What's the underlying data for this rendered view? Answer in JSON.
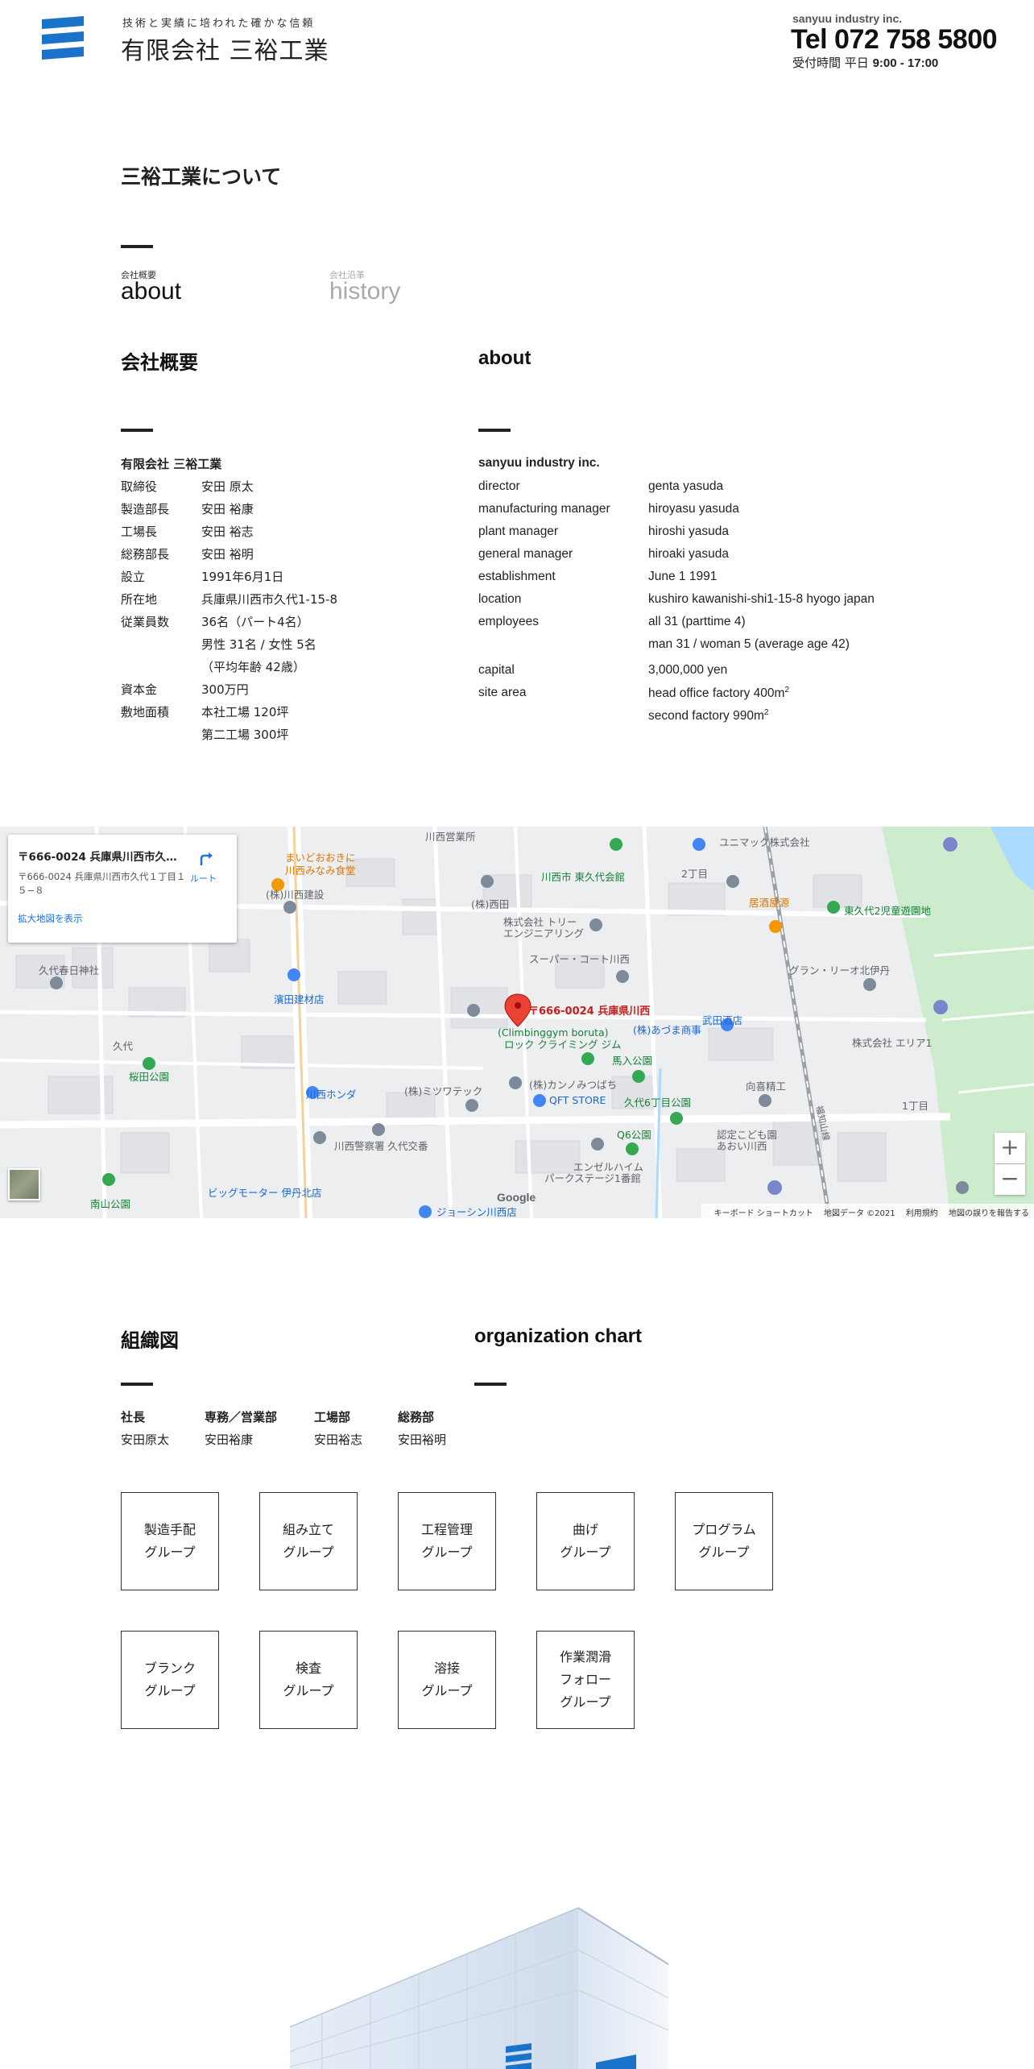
{
  "header": {
    "tagline": "技術と実績に培われた確かな信頼",
    "company_name": "有限会社 三裕工業",
    "company_en": "sanyuu industry inc.",
    "tel": "Tel 072 758 5800",
    "hours_label": "受付時間 平日",
    "hours_time": "9:00 - 17:00"
  },
  "page_title": "三裕工業について",
  "tabs": [
    {
      "small": "会社概要",
      "big": "about"
    },
    {
      "small": "会社沿革",
      "big": "history"
    }
  ],
  "overview_jp": {
    "heading": "会社概要",
    "company": "有限会社 三裕工業",
    "rows": [
      {
        "label": "取締役",
        "values": [
          "安田 原太"
        ]
      },
      {
        "label": "製造部長",
        "values": [
          "安田 裕康"
        ]
      },
      {
        "label": "工場長",
        "values": [
          "安田 裕志"
        ]
      },
      {
        "label": "総務部長",
        "values": [
          "安田 裕明"
        ]
      },
      {
        "label": "設立",
        "values": [
          "1991年6月1日"
        ]
      },
      {
        "label": "所在地",
        "values": [
          "兵庫県川西市久代1-15-8"
        ]
      },
      {
        "label": "従業員数",
        "values": [
          "36名（パート4名）",
          "男性 31名 / 女性 5名",
          "（平均年齢 42歳）"
        ]
      },
      {
        "label": "資本金",
        "values": [
          "300万円"
        ]
      },
      {
        "label": "敷地面積",
        "values": [
          "本社工場 120坪",
          "第二工場 300坪"
        ]
      }
    ]
  },
  "overview_en": {
    "heading": "about",
    "company": "sanyuu industry inc.",
    "rows": [
      {
        "label": "director",
        "values": [
          "genta yasuda"
        ]
      },
      {
        "label": "manufacturing manager",
        "values": [
          "hiroyasu yasuda"
        ]
      },
      {
        "label": "plant manager",
        "values": [
          "hiroshi yasuda"
        ]
      },
      {
        "label": "general manager",
        "values": [
          "hiroaki yasuda"
        ]
      },
      {
        "label": "establishment",
        "values": [
          "June 1 1991"
        ]
      },
      {
        "label": "location",
        "values": [
          "kushiro kawanishi-shi1-15-8 hyogo japan"
        ]
      },
      {
        "label": "employees",
        "values": [
          "all 31 (parttime 4)",
          "man 31 / woman 5 (average age 42)"
        ]
      },
      {
        "label": "capital",
        "values": [
          "3,000,000 yen"
        ]
      },
      {
        "label": "site area",
        "values": [
          "head office factory 400m",
          "second factory 990m"
        ]
      }
    ],
    "superscript": "2"
  },
  "map": {
    "card_title": "〒666-0024 兵庫県川西市久代...",
    "card_address": "〒666-0024 兵庫県川西市久代１丁目１５−８",
    "route_label": "ルート",
    "enlarge_link": "拡大地図を表示",
    "pin_label": "〒666-0024 兵庫県川西",
    "zoom_in": "+",
    "zoom_out": "−",
    "google": "Google",
    "footer": [
      "キーボード ショートカット",
      "地図データ ©2021",
      "利用規約",
      "地図の誤りを報告する"
    ],
    "labels": [
      {
        "text": "川西営業所",
        "color": "#5f6368"
      },
      {
        "text": "ユニマック株式会社",
        "color": "#5f6368"
      },
      {
        "text": "まいどおおきに",
        "color": "#e37400"
      },
      {
        "text": "川西みなみ食堂",
        "color": "#e37400"
      },
      {
        "text": "川西市 東久代会館",
        "color": "#188038"
      },
      {
        "text": "(株)川西建設",
        "color": "#5f6368"
      },
      {
        "text": "(株)西田",
        "color": "#5f6368"
      },
      {
        "text": "居酒屋源",
        "color": "#e37400"
      },
      {
        "text": "東久代2児童遊園地",
        "color": "#188038"
      },
      {
        "text": "株式会社 トリー",
        "color": "#5f6368"
      },
      {
        "text": "エンジニアリング",
        "color": "#5f6368"
      },
      {
        "text": "スーパー・コート川西",
        "color": "#5f6368"
      },
      {
        "text": "グラン・リーオ北伊丹",
        "color": "#5f6368"
      },
      {
        "text": "久代春日神社",
        "color": "#5f6368"
      },
      {
        "text": "濱田建材店",
        "color": "#1967d2"
      },
      {
        "text": "(株)あづま商事",
        "color": "#1967d2"
      },
      {
        "text": "武田酒店",
        "color": "#1967d2"
      },
      {
        "text": "株式会社 エリア1",
        "color": "#5f6368"
      },
      {
        "text": "(Climbinggym boruta)",
        "color": "#188038"
      },
      {
        "text": "ロック クライミング ジム",
        "color": "#188038"
      },
      {
        "text": "馬入公園",
        "color": "#188038"
      },
      {
        "text": "桜田公園",
        "color": "#188038"
      },
      {
        "text": "川西ホンダ",
        "color": "#1967d2"
      },
      {
        "text": "(株)ミツワテック",
        "color": "#5f6368"
      },
      {
        "text": "(株)カンノみつばち",
        "color": "#5f6368"
      },
      {
        "text": "向喜精工",
        "color": "#5f6368"
      },
      {
        "text": "QFT STORE",
        "color": "#1967d2"
      },
      {
        "text": "久代6丁目公園",
        "color": "#188038"
      },
      {
        "text": "川西警察署 久代交番",
        "color": "#5f6368"
      },
      {
        "text": "Q6公園",
        "color": "#188038"
      },
      {
        "text": "認定こども園",
        "color": "#5f6368"
      },
      {
        "text": "あおい川西",
        "color": "#5f6368"
      },
      {
        "text": "エンゼルハイム",
        "color": "#5f6368"
      },
      {
        "text": "パークステージ1番館",
        "color": "#5f6368"
      },
      {
        "text": "ビッグモーター 伊丹北店",
        "color": "#1967d2"
      },
      {
        "text": "南山公園",
        "color": "#188038"
      },
      {
        "text": "ジョーシン川西店",
        "color": "#1967d2"
      },
      {
        "text": "久代",
        "color": "#5f6368"
      },
      {
        "text": "2丁目",
        "color": "#5f6368"
      },
      {
        "text": "1丁目",
        "color": "#5f6368"
      },
      {
        "text": "福知山線",
        "color": "#5f6368"
      }
    ]
  },
  "org": {
    "heading": "組織図",
    "heading_en": "organization chart",
    "roles": [
      {
        "title": "社長",
        "name": "安田原太"
      },
      {
        "title": "専務／営業部",
        "name": "安田裕康"
      },
      {
        "title": "工場部",
        "name": "安田裕志"
      },
      {
        "title": "総務部",
        "name": "安田裕明"
      }
    ],
    "groups": [
      "製造手配\nグループ",
      "組み立て\nグループ",
      "工程管理\nグループ",
      "曲げ\nグループ",
      "プログラム\nグループ",
      "ブランク\nグループ",
      "検査\nグループ",
      "溶接\nグループ",
      "作業潤滑\nフォロー\nグループ"
    ]
  },
  "colors": {
    "brand_blue": "#1a73c8",
    "text": "#222222",
    "map_red": "#d93025"
  }
}
